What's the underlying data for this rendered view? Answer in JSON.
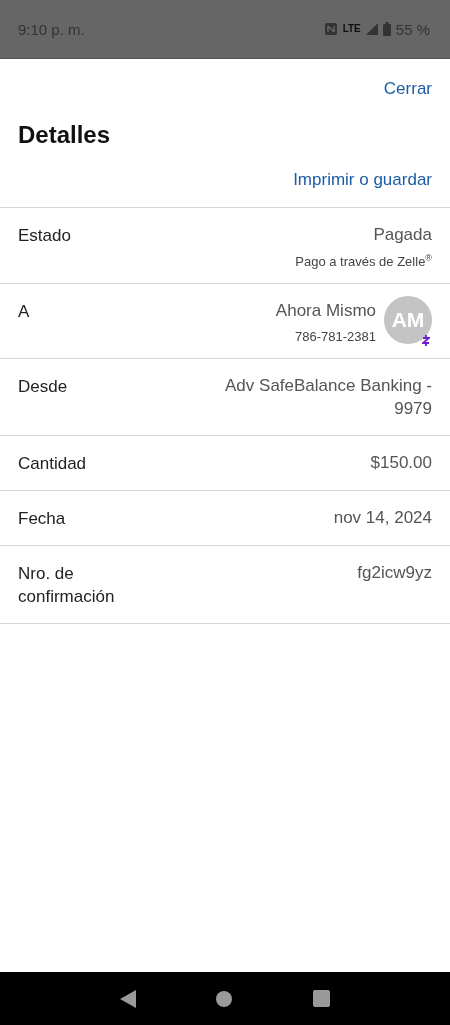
{
  "status_bar": {
    "time": "9:10 p. m.",
    "network": "LTE",
    "battery": "55 %"
  },
  "close": "Cerrar",
  "title": "Detalles",
  "print": "Imprimir o guardar",
  "rows": [
    {
      "label": "Estado",
      "value": "Pagada",
      "subtext": "Pago a través de Zelle$^{®}$"
    },
    {
      "label": "A",
      "value": "Ahora Mismo",
      "subtext": "786-781-2381",
      "avatar": "AM"
    },
    {
      "label": "Desde",
      "value": "Adv SafeBalance Banking - 9979"
    },
    {
      "label": "Cantidad",
      "value": "$150.00"
    },
    {
      "label": "Fecha",
      "value": "nov 14, 2024"
    },
    {
      "label": "Nro. de confirmación",
      "value": "fg2icw9yz"
    }
  ]
}
